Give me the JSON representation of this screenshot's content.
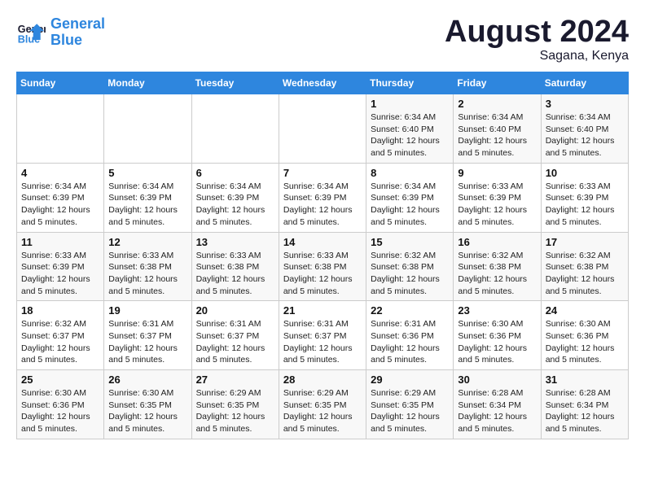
{
  "header": {
    "logo_line1": "General",
    "logo_line2": "Blue",
    "main_title": "August 2024",
    "sub_title": "Sagana, Kenya"
  },
  "weekdays": [
    "Sunday",
    "Monday",
    "Tuesday",
    "Wednesday",
    "Thursday",
    "Friday",
    "Saturday"
  ],
  "weeks": [
    [
      {
        "day": "",
        "detail": ""
      },
      {
        "day": "",
        "detail": ""
      },
      {
        "day": "",
        "detail": ""
      },
      {
        "day": "",
        "detail": ""
      },
      {
        "day": "1",
        "detail": "Sunrise: 6:34 AM\nSunset: 6:40 PM\nDaylight: 12 hours\nand 5 minutes."
      },
      {
        "day": "2",
        "detail": "Sunrise: 6:34 AM\nSunset: 6:40 PM\nDaylight: 12 hours\nand 5 minutes."
      },
      {
        "day": "3",
        "detail": "Sunrise: 6:34 AM\nSunset: 6:40 PM\nDaylight: 12 hours\nand 5 minutes."
      }
    ],
    [
      {
        "day": "4",
        "detail": "Sunrise: 6:34 AM\nSunset: 6:39 PM\nDaylight: 12 hours\nand 5 minutes."
      },
      {
        "day": "5",
        "detail": "Sunrise: 6:34 AM\nSunset: 6:39 PM\nDaylight: 12 hours\nand 5 minutes."
      },
      {
        "day": "6",
        "detail": "Sunrise: 6:34 AM\nSunset: 6:39 PM\nDaylight: 12 hours\nand 5 minutes."
      },
      {
        "day": "7",
        "detail": "Sunrise: 6:34 AM\nSunset: 6:39 PM\nDaylight: 12 hours\nand 5 minutes."
      },
      {
        "day": "8",
        "detail": "Sunrise: 6:34 AM\nSunset: 6:39 PM\nDaylight: 12 hours\nand 5 minutes."
      },
      {
        "day": "9",
        "detail": "Sunrise: 6:33 AM\nSunset: 6:39 PM\nDaylight: 12 hours\nand 5 minutes."
      },
      {
        "day": "10",
        "detail": "Sunrise: 6:33 AM\nSunset: 6:39 PM\nDaylight: 12 hours\nand 5 minutes."
      }
    ],
    [
      {
        "day": "11",
        "detail": "Sunrise: 6:33 AM\nSunset: 6:39 PM\nDaylight: 12 hours\nand 5 minutes."
      },
      {
        "day": "12",
        "detail": "Sunrise: 6:33 AM\nSunset: 6:38 PM\nDaylight: 12 hours\nand 5 minutes."
      },
      {
        "day": "13",
        "detail": "Sunrise: 6:33 AM\nSunset: 6:38 PM\nDaylight: 12 hours\nand 5 minutes."
      },
      {
        "day": "14",
        "detail": "Sunrise: 6:33 AM\nSunset: 6:38 PM\nDaylight: 12 hours\nand 5 minutes."
      },
      {
        "day": "15",
        "detail": "Sunrise: 6:32 AM\nSunset: 6:38 PM\nDaylight: 12 hours\nand 5 minutes."
      },
      {
        "day": "16",
        "detail": "Sunrise: 6:32 AM\nSunset: 6:38 PM\nDaylight: 12 hours\nand 5 minutes."
      },
      {
        "day": "17",
        "detail": "Sunrise: 6:32 AM\nSunset: 6:38 PM\nDaylight: 12 hours\nand 5 minutes."
      }
    ],
    [
      {
        "day": "18",
        "detail": "Sunrise: 6:32 AM\nSunset: 6:37 PM\nDaylight: 12 hours\nand 5 minutes."
      },
      {
        "day": "19",
        "detail": "Sunrise: 6:31 AM\nSunset: 6:37 PM\nDaylight: 12 hours\nand 5 minutes."
      },
      {
        "day": "20",
        "detail": "Sunrise: 6:31 AM\nSunset: 6:37 PM\nDaylight: 12 hours\nand 5 minutes."
      },
      {
        "day": "21",
        "detail": "Sunrise: 6:31 AM\nSunset: 6:37 PM\nDaylight: 12 hours\nand 5 minutes."
      },
      {
        "day": "22",
        "detail": "Sunrise: 6:31 AM\nSunset: 6:36 PM\nDaylight: 12 hours\nand 5 minutes."
      },
      {
        "day": "23",
        "detail": "Sunrise: 6:30 AM\nSunset: 6:36 PM\nDaylight: 12 hours\nand 5 minutes."
      },
      {
        "day": "24",
        "detail": "Sunrise: 6:30 AM\nSunset: 6:36 PM\nDaylight: 12 hours\nand 5 minutes."
      }
    ],
    [
      {
        "day": "25",
        "detail": "Sunrise: 6:30 AM\nSunset: 6:36 PM\nDaylight: 12 hours\nand 5 minutes."
      },
      {
        "day": "26",
        "detail": "Sunrise: 6:30 AM\nSunset: 6:35 PM\nDaylight: 12 hours\nand 5 minutes."
      },
      {
        "day": "27",
        "detail": "Sunrise: 6:29 AM\nSunset: 6:35 PM\nDaylight: 12 hours\nand 5 minutes."
      },
      {
        "day": "28",
        "detail": "Sunrise: 6:29 AM\nSunset: 6:35 PM\nDaylight: 12 hours\nand 5 minutes."
      },
      {
        "day": "29",
        "detail": "Sunrise: 6:29 AM\nSunset: 6:35 PM\nDaylight: 12 hours\nand 5 minutes."
      },
      {
        "day": "30",
        "detail": "Sunrise: 6:28 AM\nSunset: 6:34 PM\nDaylight: 12 hours\nand 5 minutes."
      },
      {
        "day": "31",
        "detail": "Sunrise: 6:28 AM\nSunset: 6:34 PM\nDaylight: 12 hours\nand 5 minutes."
      }
    ]
  ]
}
